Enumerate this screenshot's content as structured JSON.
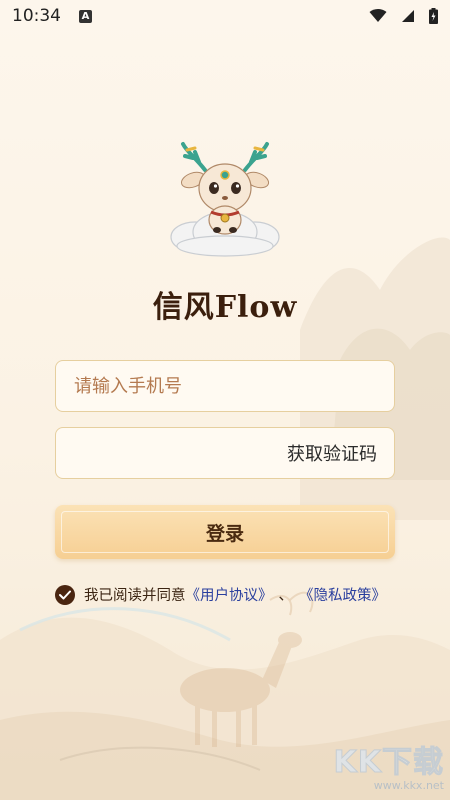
{
  "status_bar": {
    "time": "10:34",
    "notification_icon": "a-notification-icon",
    "wifi_icon": "wifi-icon",
    "signal_icon": "signal-icon",
    "battery_icon": "battery-charging-icon"
  },
  "app": {
    "title": "信风Flow",
    "mascot": "deer-mascot-icon"
  },
  "login_form": {
    "phone_placeholder": "请输入手机号",
    "phone_value": "",
    "code_placeholder": "",
    "code_value": "",
    "get_code_label": "获取验证码",
    "login_label": "登录"
  },
  "agreement": {
    "checked": true,
    "prefix": "我已阅读并同意",
    "user_agreement": "《用户协议》",
    "separator": "、",
    "privacy_policy": "《隐私政策》"
  },
  "watermark": {
    "brand": "KK下载",
    "url": "www.kkx.net"
  },
  "colors": {
    "background": "#fdf6ec",
    "input_border": "#e6cf9f",
    "placeholder": "#b47a50",
    "button": "#f6cf93",
    "link": "#2a3f9e",
    "title": "#3b1f0d",
    "checkbox": "#4a2510"
  }
}
